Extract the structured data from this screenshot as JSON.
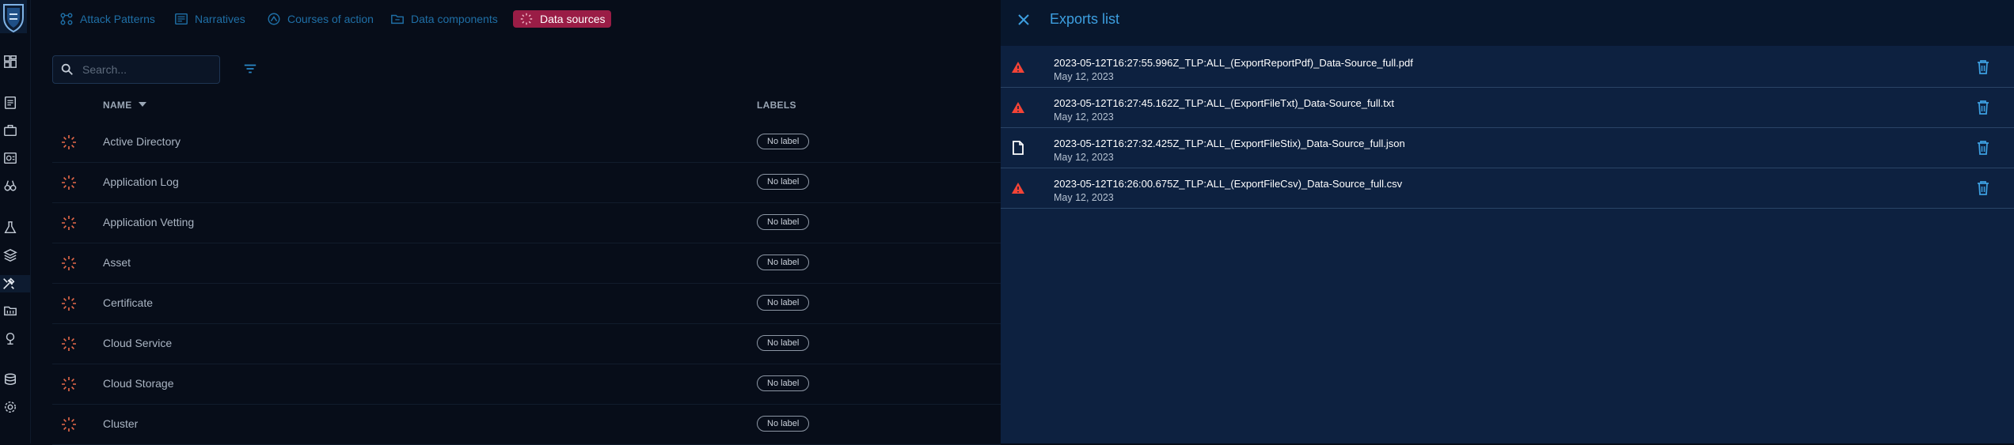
{
  "topbar": {
    "items": [
      {
        "label": "Attack Patterns",
        "icon": "attack-pattern-icon"
      },
      {
        "label": "Narratives",
        "icon": "narrative-icon"
      },
      {
        "label": "Courses of action",
        "icon": "course-of-action-icon"
      },
      {
        "label": "Data components",
        "icon": "data-component-icon"
      },
      {
        "label": "Data sources",
        "icon": "data-source-icon",
        "active": true
      }
    ]
  },
  "search": {
    "placeholder": "Search..."
  },
  "table": {
    "headers": {
      "name": "NAME",
      "labels": "LABELS"
    },
    "rows": [
      {
        "name": "Active Directory",
        "label": "No label"
      },
      {
        "name": "Application Log",
        "label": "No label"
      },
      {
        "name": "Application Vetting",
        "label": "No label"
      },
      {
        "name": "Asset",
        "label": "No label"
      },
      {
        "name": "Certificate",
        "label": "No label"
      },
      {
        "name": "Cloud Service",
        "label": "No label"
      },
      {
        "name": "Cloud Storage",
        "label": "No label"
      },
      {
        "name": "Cluster",
        "label": "No label"
      }
    ]
  },
  "drawer": {
    "title": "Exports list",
    "exports": [
      {
        "file": "2023-05-12T16:27:55.996Z_TLP:ALL_(ExportReportPdf)_Data-Source_full.pdf",
        "date": "May 12, 2023",
        "status": "error"
      },
      {
        "file": "2023-05-12T16:27:45.162Z_TLP:ALL_(ExportFileTxt)_Data-Source_full.txt",
        "date": "May 12, 2023",
        "status": "error"
      },
      {
        "file": "2023-05-12T16:27:32.425Z_TLP:ALL_(ExportFileStix)_Data-Source_full.json",
        "date": "May 12, 2023",
        "status": "complete"
      },
      {
        "file": "2023-05-12T16:26:00.675Z_TLP:ALL_(ExportFileCsv)_Data-Source_full.csv",
        "date": "May 12, 2023",
        "status": "error"
      }
    ]
  },
  "colors": {
    "background": "#070d19",
    "drawer": "#0d2140",
    "accent_blue": "#3d9fe0",
    "active_tab": "#9a1d46",
    "error": "#f44336",
    "data_source_icon": "#e86a4a"
  }
}
